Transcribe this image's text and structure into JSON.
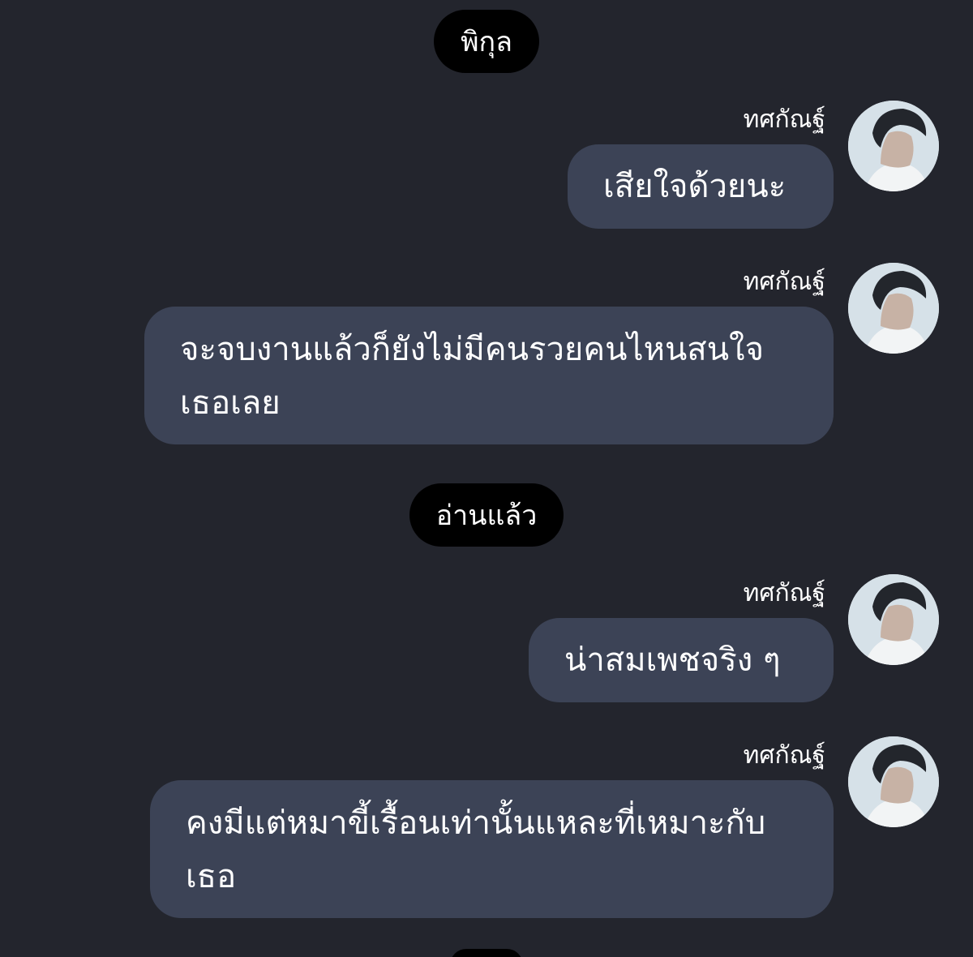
{
  "chat": {
    "contact_name": "พิกุล",
    "read_label": "อ่านแล้ว",
    "messages": [
      {
        "sender": "ทศกัณฐ์",
        "text": "เสียใจด้วยนะ"
      },
      {
        "sender": "ทศกัณฐ์",
        "text": "จะจบงานแล้วก็ยังไม่มีคนรวยคนไหนสนใจเธอเลย"
      },
      {
        "sender": "ทศกัณฐ์",
        "text": "น่าสมเพชจริง ๆ"
      },
      {
        "sender": "ทศกัณฐ์",
        "text": "คงมีแต่หมาขี้เรื้อนเท่านั้นแหละที่เหมาะกับเธอ"
      }
    ]
  },
  "colors": {
    "background": "#23252d",
    "bubble": "#3c4356",
    "pill": "#000000",
    "text": "#ffffff"
  },
  "icons": {
    "avatar": "sender-avatar-photo"
  }
}
